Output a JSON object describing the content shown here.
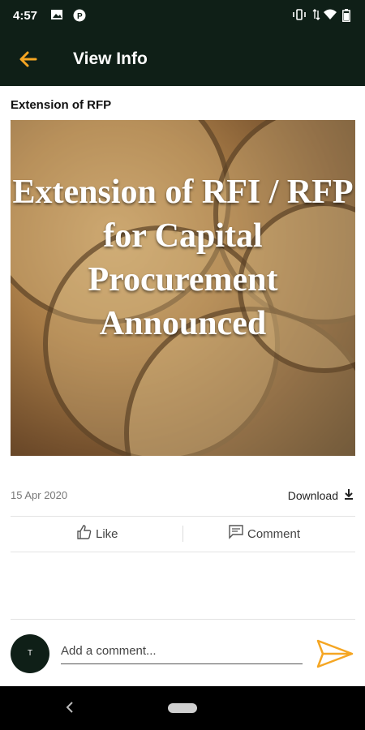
{
  "status_bar": {
    "time": "4:57",
    "left_icons": [
      "image-icon",
      "parking-icon"
    ],
    "right_icons": [
      "vibrate-icon",
      "data-icon",
      "wifi-icon",
      "battery-icon"
    ]
  },
  "app_bar": {
    "title": "View Info",
    "back_icon": "arrow-left-icon",
    "background": "#0f1f17",
    "accent": "#f5a623"
  },
  "post": {
    "title": "Extension of RFP",
    "image_text": "Extension of RFI / RFP for Capital Procurement Announced",
    "date": "15 Apr 2020",
    "download_label": "Download"
  },
  "actions": {
    "like_label": "Like",
    "comment_label": "Comment"
  },
  "comment_box": {
    "avatar_initial": "T",
    "placeholder": "Add a comment..."
  }
}
